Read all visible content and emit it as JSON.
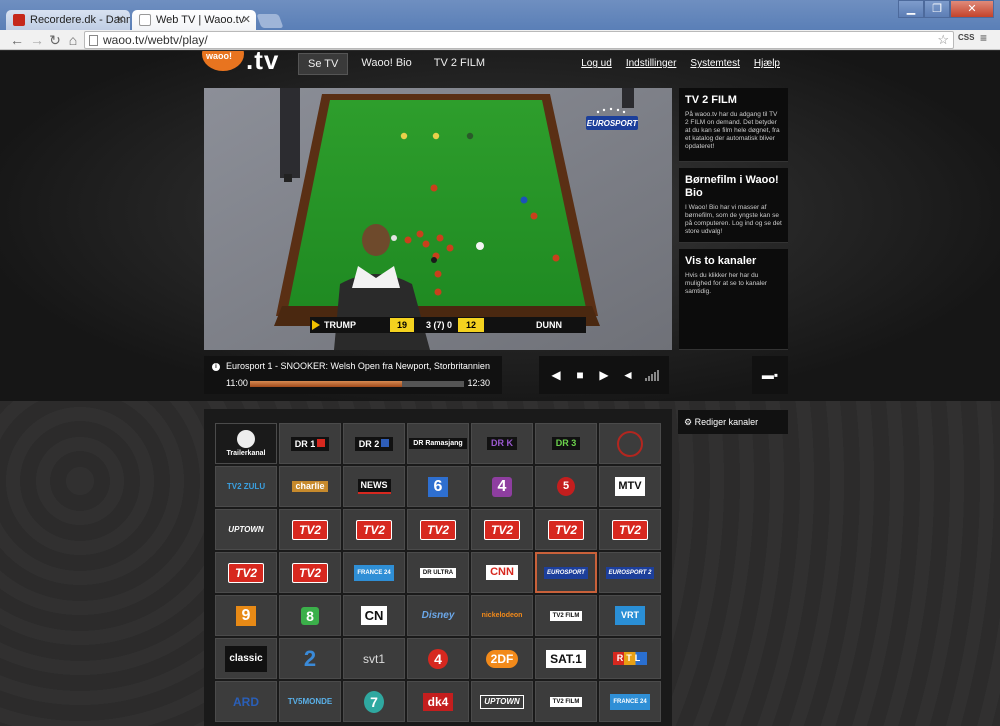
{
  "browser": {
    "tabs": [
      {
        "label": "Recordere.dk - Danmarks",
        "active": false
      },
      {
        "label": "Web TV | Waoo.tv",
        "active": true
      }
    ],
    "url": "waoo.tv/webtv/play/",
    "ext_label": "CSS"
  },
  "site": {
    "logo_word": "waoo!",
    "logo_tv": ".tv",
    "nav": [
      {
        "label": "Se TV",
        "active": true
      },
      {
        "label": "Waoo! Bio",
        "active": false
      },
      {
        "label": "TV 2 FILM",
        "active": false
      }
    ],
    "user_links": [
      "Log ud",
      "Indstillinger",
      "Systemtest",
      "Hjælp"
    ]
  },
  "player": {
    "score": {
      "player1": "TRUMP",
      "score1": "19",
      "frames": "3 (7) 0",
      "score2": "12",
      "player2": "DUNN"
    },
    "channel_logo": "EUROSPORT",
    "program_title": "Eurosport 1 - SNOOKER: Welsh Open fra Newport, Storbritannien",
    "start_time": "11:00",
    "end_time": "12:30",
    "progress": 0.71
  },
  "side_boxes": [
    {
      "title": "TV 2 FILM",
      "text": "På waoo.tv har du adgang til TV 2 FILM on demand. Det betyder at du kan se film hele døgnet, fra et katalog der automatisk bliver opdateret!"
    },
    {
      "title": "Børnefilm i Waoo! Bio",
      "text": "I Waoo! Bio har vi masser af børnefilm, som de yngste kan se på computeren. Log ind og se det store udvalg!"
    },
    {
      "title": "Vis to kanaler",
      "text": "Hvis du klikker her har du mulighed for at se to kanaler samtidig."
    }
  ],
  "edit_channels_label": "Rediger kanaler",
  "channels": [
    {
      "name": "Trailerkanal",
      "logo": "Trailerkanal",
      "style": "trailer"
    },
    {
      "name": "DR1",
      "logo": "DR 1",
      "style": "dr1"
    },
    {
      "name": "DR2",
      "logo": "DR 2",
      "style": "dr2"
    },
    {
      "name": "DR Ramasjang",
      "logo": "DR Ramasjang",
      "style": "drr"
    },
    {
      "name": "DR K",
      "logo": "DR K",
      "style": "drk"
    },
    {
      "name": "DR3",
      "logo": "DR 3",
      "style": "dr3"
    },
    {
      "name": "Channel seal",
      "logo": "",
      "style": "seal"
    },
    {
      "name": "TV 2 Zulu",
      "logo": "TV2 ZULU",
      "style": "zulu"
    },
    {
      "name": "TV 2 Charlie",
      "logo": "charlie",
      "style": "charlie"
    },
    {
      "name": "TV 2 News",
      "logo": "NEWS",
      "style": "news"
    },
    {
      "name": "Kanal 6",
      "logo": "6",
      "style": "k6"
    },
    {
      "name": "Kanal 4",
      "logo": "4",
      "style": "k4"
    },
    {
      "name": "Kanal 5",
      "logo": "5",
      "style": "k5"
    },
    {
      "name": "MTV",
      "logo": "MTV",
      "style": "mtv"
    },
    {
      "name": "TV 2 Fri",
      "logo": "UPTOWN",
      "style": "uptown"
    },
    {
      "name": "TV 2 Regional 1",
      "logo": "TV2",
      "style": "tv2"
    },
    {
      "name": "TV 2 Regional 2",
      "logo": "TV2",
      "style": "tv2"
    },
    {
      "name": "TV 2 Regional 3",
      "logo": "TV2",
      "style": "tv2"
    },
    {
      "name": "TV 2 Regional 4",
      "logo": "TV2",
      "style": "tv2"
    },
    {
      "name": "TV 2 Regional 5",
      "logo": "TV2",
      "style": "tv2"
    },
    {
      "name": "TV 2 Regional 6",
      "logo": "TV2",
      "style": "tv2"
    },
    {
      "name": "TV 2 Regional 7",
      "logo": "TV2",
      "style": "tv2"
    },
    {
      "name": "TV 2 Regional 8",
      "logo": "TV2",
      "style": "tv2"
    },
    {
      "name": "France 24",
      "logo": "FRANCE 24",
      "style": "f24"
    },
    {
      "name": "DR Ultra",
      "logo": "DR ULTRA",
      "style": "drultra"
    },
    {
      "name": "CNN",
      "logo": "CNN",
      "style": "cnn"
    },
    {
      "name": "Eurosport 1",
      "logo": "EUROSPORT",
      "style": "euro",
      "selected": true
    },
    {
      "name": "Eurosport 2",
      "logo": "EUROSPORT 2",
      "style": "euro2"
    },
    {
      "name": "Kanal 9",
      "logo": "9",
      "style": "k9"
    },
    {
      "name": "Kanal 8",
      "logo": "8",
      "style": "k8"
    },
    {
      "name": "Cartoon Network",
      "logo": "CN",
      "style": "cn"
    },
    {
      "name": "Disney Channel",
      "logo": "Disney",
      "style": "disney"
    },
    {
      "name": "Nickelodeon",
      "logo": "nickelodeon",
      "style": "nick"
    },
    {
      "name": "TV 2 Film",
      "logo": "TV2 FILM",
      "style": "tv2film"
    },
    {
      "name": "VRT",
      "logo": "VRT",
      "style": "vrt"
    },
    {
      "name": "Classic",
      "logo": "classic",
      "style": "classic"
    },
    {
      "name": "NRK2",
      "logo": "2",
      "style": "nrk2"
    },
    {
      "name": "SVT1",
      "logo": "svt1",
      "style": "svt1"
    },
    {
      "name": "TV4",
      "logo": "4",
      "style": "tv4"
    },
    {
      "name": "ZDF",
      "logo": "2DF",
      "style": "zdf"
    },
    {
      "name": "Sat.1",
      "logo": "SAT.1",
      "style": "sat1"
    },
    {
      "name": "RTL",
      "logo": "RTL",
      "style": "rtl"
    },
    {
      "name": "ARD",
      "logo": "ARD",
      "style": "ard"
    },
    {
      "name": "TV5 Monde",
      "logo": "TV5MONDE",
      "style": "tv5"
    },
    {
      "name": "Kanal 7",
      "logo": "7",
      "style": "k7"
    },
    {
      "name": "DK4",
      "logo": "dk4",
      "style": "dk4"
    },
    {
      "name": "Uptown",
      "logo": "UPTOWN",
      "style": "uptown2"
    },
    {
      "name": "TV 2 Film 2",
      "logo": "TV2 FILM",
      "style": "tv2film"
    },
    {
      "name": "France 24 2",
      "logo": "FRANCE 24",
      "style": "f24"
    }
  ]
}
